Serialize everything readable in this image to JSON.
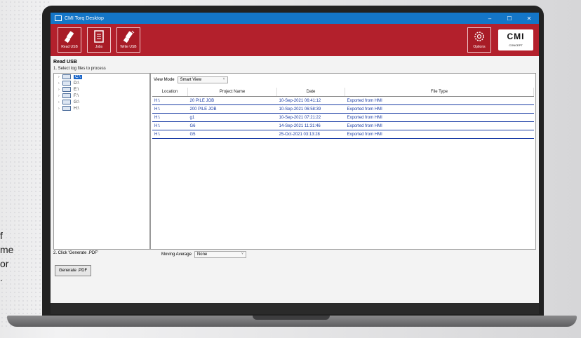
{
  "background_text": {
    "lines": [
      "f",
      "me",
      "or",
      "."
    ]
  },
  "window": {
    "title": "CMI Torq Desktop",
    "min": "–",
    "max": "☐",
    "close": "✕"
  },
  "toolbar": {
    "read_usb": "Read USB",
    "jobs": "Jobs",
    "write_usb": "Write USB",
    "options": "Options"
  },
  "logo": {
    "text": "CMI",
    "sub": "CONCEPT"
  },
  "page": {
    "title": "Read USB",
    "step1": "1. Select log files to process"
  },
  "tree": {
    "items": [
      "C:\\",
      "D:\\",
      "E:\\",
      "F:\\",
      "G:\\",
      "H:\\"
    ]
  },
  "viewmode": {
    "label": "View Mode",
    "value": "Smart View"
  },
  "table": {
    "headers": [
      "Location",
      "Project Name",
      "Date",
      "File Type"
    ],
    "rows": [
      [
        "H:\\",
        "20 PILE JOB",
        "10-Sep-2021 06:41:12",
        "Exported from HMI"
      ],
      [
        "H:\\",
        "200 PILE JOB",
        "10-Sep-2021 06:58:39",
        "Exported from HMI"
      ],
      [
        "H:\\",
        "g1",
        "10-Sep-2021 07:21:22",
        "Exported from HMI"
      ],
      [
        "H:\\",
        "G6",
        "14-Sep-2021 11:31:46",
        "Exported from HMI"
      ],
      [
        "H:\\",
        "G5",
        "25-Oct-2021 03:13:28",
        "Exported from HMI"
      ]
    ]
  },
  "step2": "2. Click 'Generate .PDF'",
  "moving_average": {
    "label": "Moving Average",
    "value": "None"
  },
  "generate_button": "Generate .PDF",
  "colors": {
    "brand_red": "#b3202c",
    "titlebar_blue": "#1476c8",
    "link_blue": "#1b3da5"
  }
}
